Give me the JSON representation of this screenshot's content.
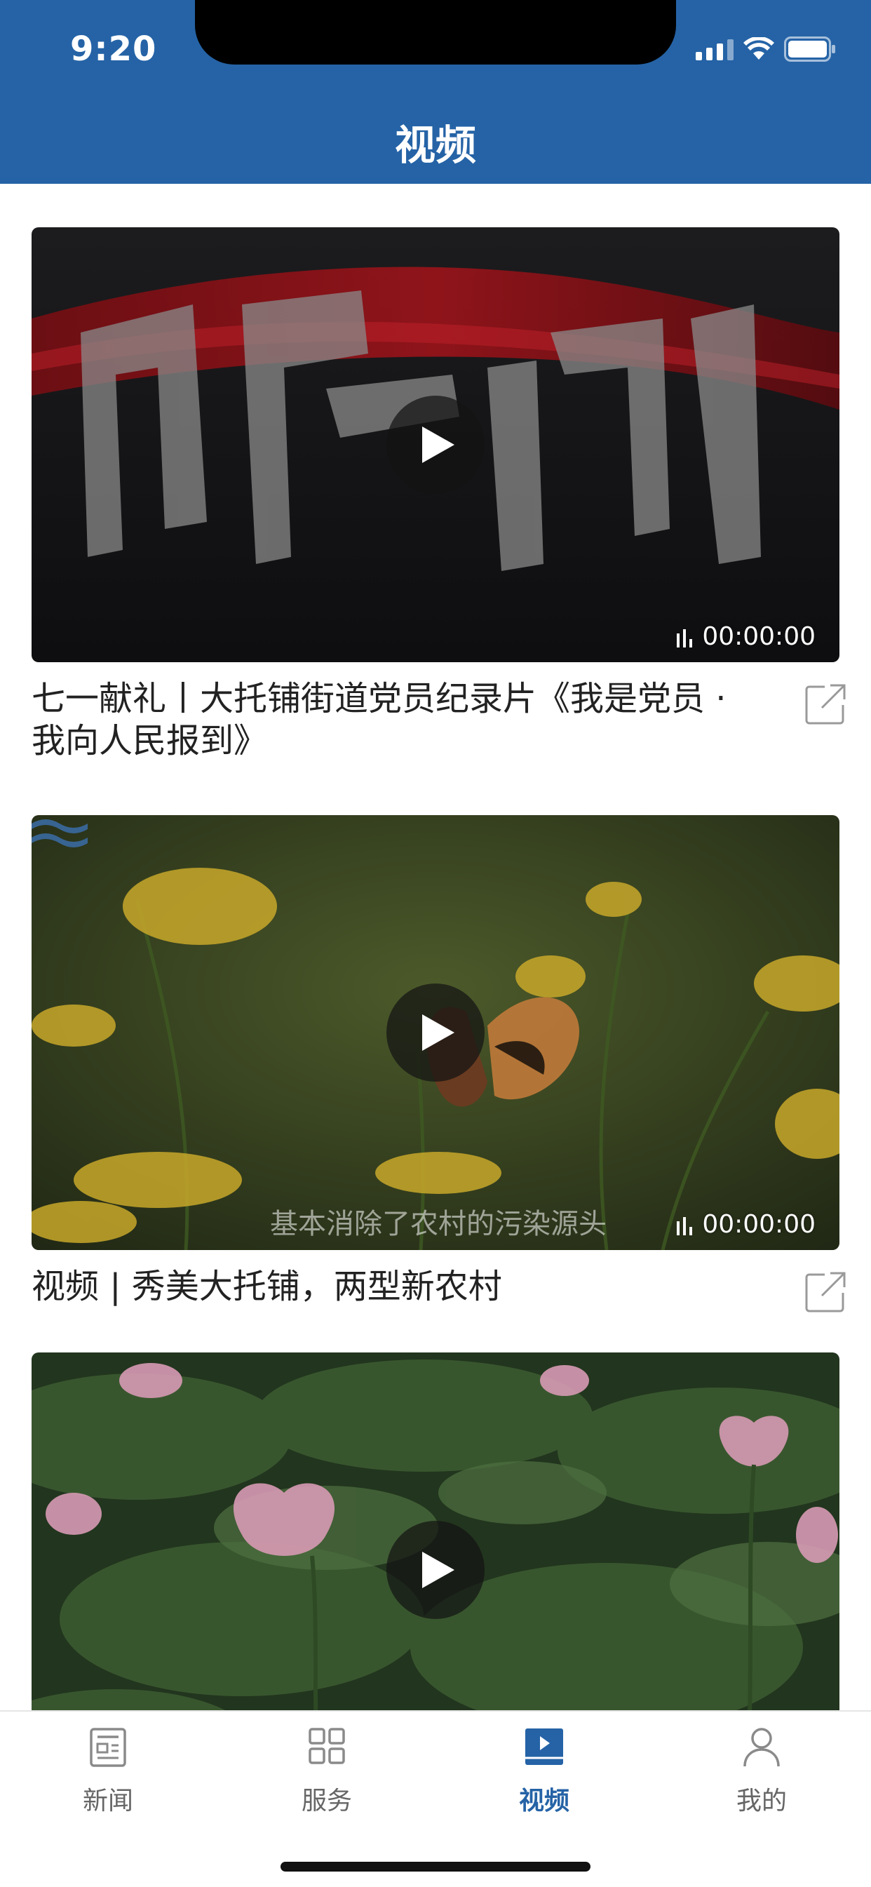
{
  "status": {
    "time": "9:20"
  },
  "header": {
    "title": "视频"
  },
  "videos": [
    {
      "title": "七一献礼丨大托铺街道党员纪录片《我是党员 · 我向人民报到》",
      "duration": "00:00:00",
      "subtitle": ""
    },
    {
      "title": "视频 | 秀美大托铺，两型新农村",
      "duration": "00:00:00",
      "subtitle": "基本消除了农村的污染源头"
    },
    {
      "title": "",
      "duration": "",
      "subtitle": ""
    }
  ],
  "tabs": [
    {
      "label": "新闻",
      "icon": "news-icon",
      "active": false
    },
    {
      "label": "服务",
      "icon": "grid-icon",
      "active": false
    },
    {
      "label": "视频",
      "icon": "video-icon",
      "active": true
    },
    {
      "label": "我的",
      "icon": "user-icon",
      "active": false
    }
  ],
  "colors": {
    "brand": "#2563a6",
    "active_tab": "#2563a6",
    "inactive_tab": "#666666"
  }
}
